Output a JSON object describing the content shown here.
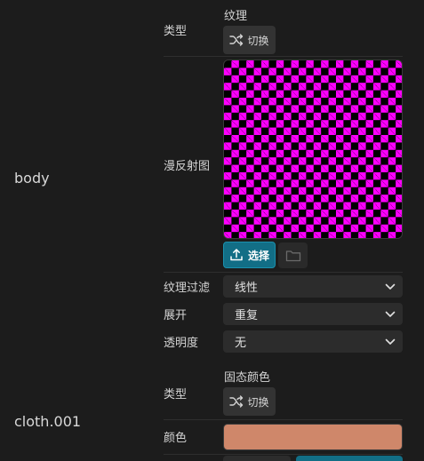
{
  "materials": [
    {
      "name": "body",
      "type_label": "类型",
      "type_value": "纹理",
      "switch_label": "切换",
      "diffuse_label": "漫反射图",
      "select_label": "选择",
      "filter": {
        "label": "纹理过滤",
        "value": "线性"
      },
      "wrap": {
        "label": "展开",
        "value": "重复"
      },
      "transparency": {
        "label": "透明度",
        "value": "无"
      }
    },
    {
      "name": "cloth.001",
      "type_label": "类型",
      "type_value": "固态颜色",
      "switch_label": "切换",
      "color_label": "颜色",
      "color": "#cf876a"
    }
  ],
  "colors": {
    "background": "#1c1c1c",
    "accent_button": "#126e86",
    "texture_a": "#ff00ff",
    "texture_b": "#000000"
  }
}
